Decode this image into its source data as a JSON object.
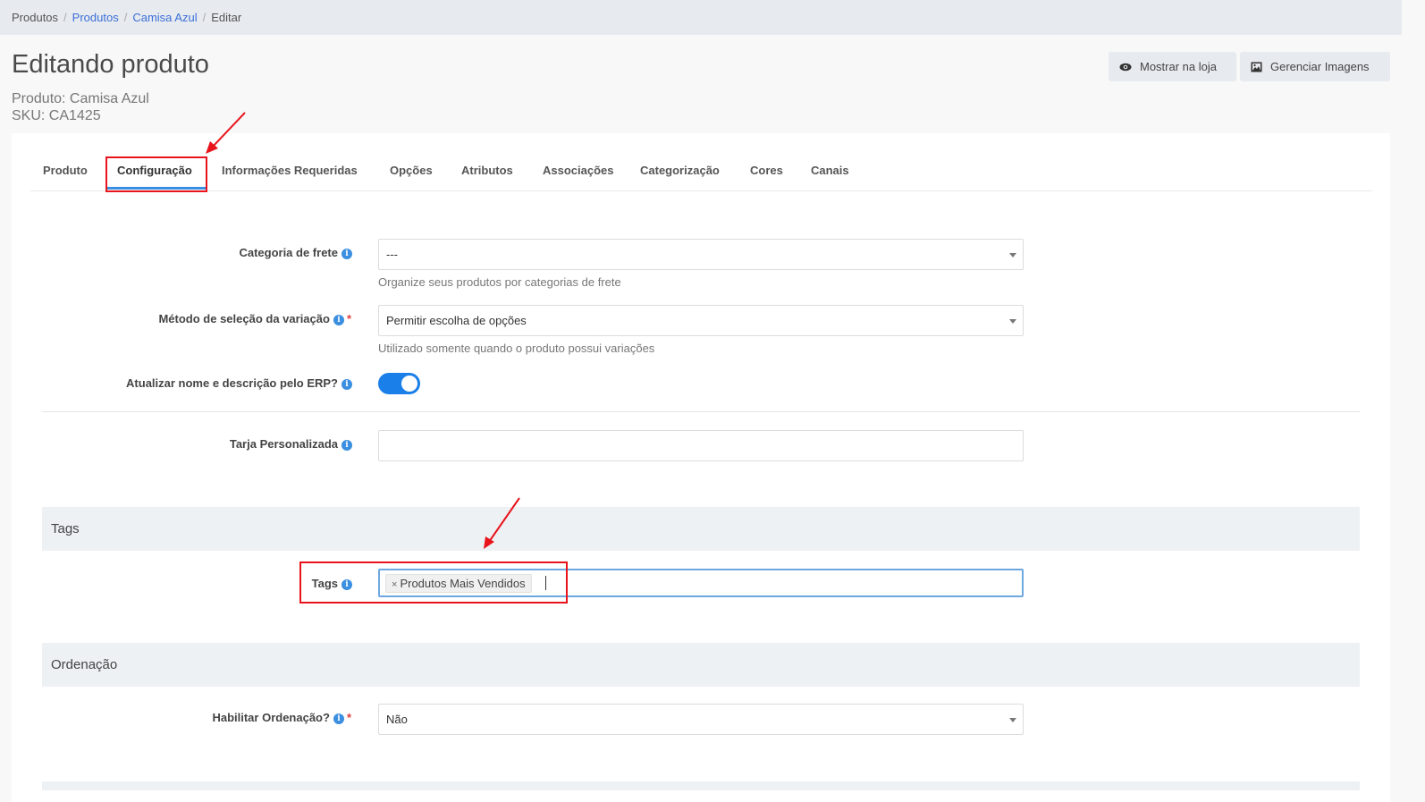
{
  "breadcrumb": [
    {
      "label": "Produtos",
      "link": false
    },
    {
      "label": "Produtos",
      "link": true
    },
    {
      "label": "Camisa Azul",
      "link": true
    },
    {
      "label": "Editar",
      "link": false
    }
  ],
  "header": {
    "title": "Editando produto",
    "product_line": "Produto: Camisa Azul",
    "sku_line": "SKU: CA1425",
    "show_store_label": "Mostrar na loja",
    "manage_images_label": "Gerenciar Imagens"
  },
  "tabs": [
    {
      "label": "Produto",
      "active": false
    },
    {
      "label": "Configuração",
      "active": true
    },
    {
      "label": "Informações Requeridas",
      "active": false
    },
    {
      "label": "Opções",
      "active": false
    },
    {
      "label": "Atributos",
      "active": false
    },
    {
      "label": "Associações",
      "active": false
    },
    {
      "label": "Categorização",
      "active": false
    },
    {
      "label": "Cores",
      "active": false
    },
    {
      "label": "Canais",
      "active": false
    }
  ],
  "form": {
    "shipping_category": {
      "label": "Categoria de frete",
      "value": "---",
      "help": "Organize seus produtos por categorias de frete"
    },
    "variation_method": {
      "label": "Método de seleção da variação",
      "required": true,
      "value": "Permitir escolha de opções",
      "help": "Utilizado somente quando o produto possui variações"
    },
    "erp_update": {
      "label": "Atualizar nome e descrição pelo ERP?",
      "enabled": true
    },
    "custom_badge": {
      "label": "Tarja Personalizada",
      "value": ""
    }
  },
  "tags_section": {
    "heading": "Tags",
    "label": "Tags",
    "chips": [
      {
        "remove": "×",
        "label": "Produtos Mais Vendidos"
      }
    ]
  },
  "ordering_section": {
    "heading": "Ordenação",
    "label": "Habilitar Ordenação?",
    "required": true,
    "value": "Não"
  },
  "colors": {
    "accent": "#3b8fe0",
    "toggle_on": "#1a7fe8",
    "annotation_red": "#e8141c",
    "link": "#3b6fd8"
  }
}
